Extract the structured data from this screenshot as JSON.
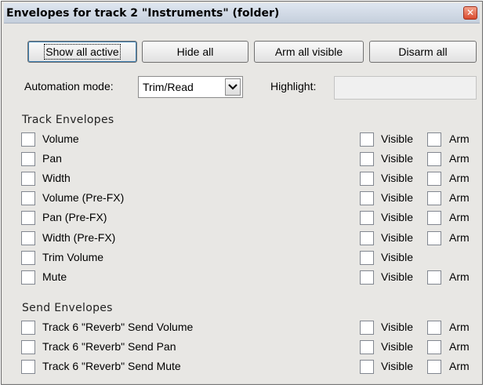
{
  "window": {
    "title": "Envelopes for track 2 \"Instruments\" (folder)",
    "close_glyph": "✕"
  },
  "toolbar": {
    "show_all_active": "Show all active",
    "hide_all": "Hide all",
    "arm_all_visible": "Arm all visible",
    "disarm_all": "Disarm all"
  },
  "automation": {
    "label": "Automation mode:",
    "value": "Trim/Read",
    "highlight_label": "Highlight:",
    "highlight_value": ""
  },
  "track_envelopes": {
    "heading": "Track Envelopes",
    "visible_label": "Visible",
    "arm_label": "Arm",
    "items": [
      {
        "label": "Volume",
        "has_arm": true
      },
      {
        "label": "Pan",
        "has_arm": true
      },
      {
        "label": "Width",
        "has_arm": true
      },
      {
        "label": "Volume (Pre-FX)",
        "has_arm": true
      },
      {
        "label": "Pan (Pre-FX)",
        "has_arm": true
      },
      {
        "label": "Width (Pre-FX)",
        "has_arm": true
      },
      {
        "label": "Trim Volume",
        "has_arm": false
      },
      {
        "label": "Mute",
        "has_arm": true
      }
    ]
  },
  "send_envelopes": {
    "heading": "Send Envelopes",
    "items": [
      {
        "label": "Track 6 \"Reverb\" Send Volume",
        "has_arm": true
      },
      {
        "label": "Track 6 \"Reverb\" Send Pan",
        "has_arm": true
      },
      {
        "label": "Track 6 \"Reverb\" Send Mute",
        "has_arm": true
      }
    ]
  },
  "colors": {
    "window_bg": "#e8e7e4",
    "titlebar": "#c5cfdc",
    "close_button": "#d94a2f"
  }
}
